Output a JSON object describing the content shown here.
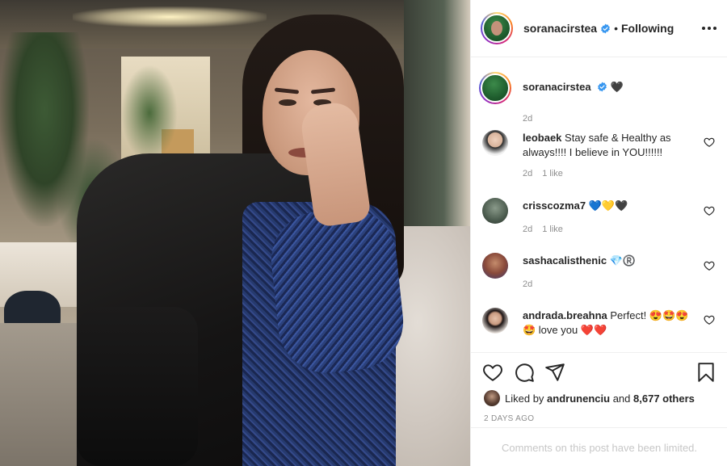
{
  "post": {
    "author": "soranacirstea",
    "follow_separator": "•",
    "follow_state": "Following",
    "caption_suffix": "🖤",
    "caption_age": "2d"
  },
  "comments": [
    {
      "user": "leobaek",
      "text": "Stay safe & Healthy as always!!!! I believe in YOU!!!!!!",
      "age": "2d",
      "likes": "1 like"
    },
    {
      "user": "crisscozma7",
      "text": "💙💛🖤",
      "age": "2d",
      "likes": "1 like"
    },
    {
      "user": "sashacalisthenic",
      "text": "💎®️",
      "age": "2d",
      "likes": ""
    },
    {
      "user": "andrada.breahna",
      "text": "Perfect! 😍🤩😍 🤩 love you ❤️❤️",
      "age": "",
      "likes": ""
    }
  ],
  "likes": {
    "prefix": "Liked by",
    "user": "andrunenciu",
    "and": "and",
    "count": "8,677 others"
  },
  "date": "2 DAYS AGO",
  "limited_notice": "Comments on this post have been limited.",
  "icons": [
    "heart-icon",
    "comment-icon",
    "share-icon",
    "bookmark-icon",
    "more-icon",
    "verified-icon"
  ],
  "colors": {
    "verified": "#3897f0",
    "text": "#262626",
    "muted": "#8e8e8e",
    "border": "#efefef"
  }
}
